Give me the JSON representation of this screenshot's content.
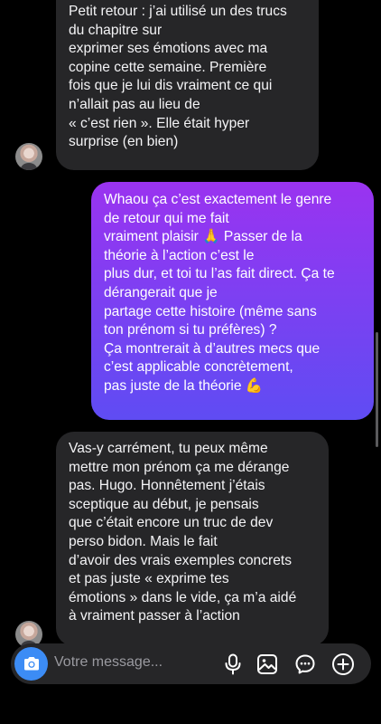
{
  "conversation": {
    "messages": [
      {
        "sender": "other",
        "lines": [
          "Petit retour : j’ai utilisé un des trucs",
          "du chapitre sur",
          "exprimer ses émotions avec ma",
          "copine cette semaine. Première",
          "fois que je lui dis vraiment ce qui",
          "n’allait pas au lieu de",
          "« c’est rien ». Elle était hyper",
          "surprise (en bien)"
        ]
      },
      {
        "sender": "me",
        "lines": [
          "Whaou ça c’est exactement le genre",
          "de retour qui me fait",
          "vraiment plaisir 🙏 Passer de la",
          "théorie à l’action c’est le",
          "plus dur, et toi tu l’as fait direct. Ça te",
          "dérangerait que je",
          "partage cette histoire (même sans",
          "ton prénom si tu préfères) ?",
          "Ça montrerait à d’autres mecs que",
          "c’est applicable concrètement,",
          "pas juste de la théorie 💪"
        ]
      },
      {
        "sender": "other",
        "lines": [
          "Vas-y carrément, tu peux même",
          "mettre mon prénom ça me dérange",
          "pas. Hugo. Honnêtement j’étais",
          "sceptique au début, je pensais",
          "que c’était encore un truc de dev",
          "perso bidon. Mais le fait",
          "d’avoir des vrais exemples concrets",
          "et pas juste « exprime tes",
          "émotions » dans le vide, ça m’a aidé",
          "à vraiment passer à l’action"
        ]
      }
    ]
  },
  "composer": {
    "placeholder": "Votre message...",
    "icons": [
      "camera-icon",
      "microphone-icon",
      "gallery-icon",
      "sticker-icon",
      "plus-icon"
    ]
  },
  "colors": {
    "background": "#000000",
    "received_bubble": "#262628",
    "sent_gradient_top": "#9a33f0",
    "sent_gradient_bottom": "#5f4cf3",
    "camera_button": "#3c8cf5"
  }
}
